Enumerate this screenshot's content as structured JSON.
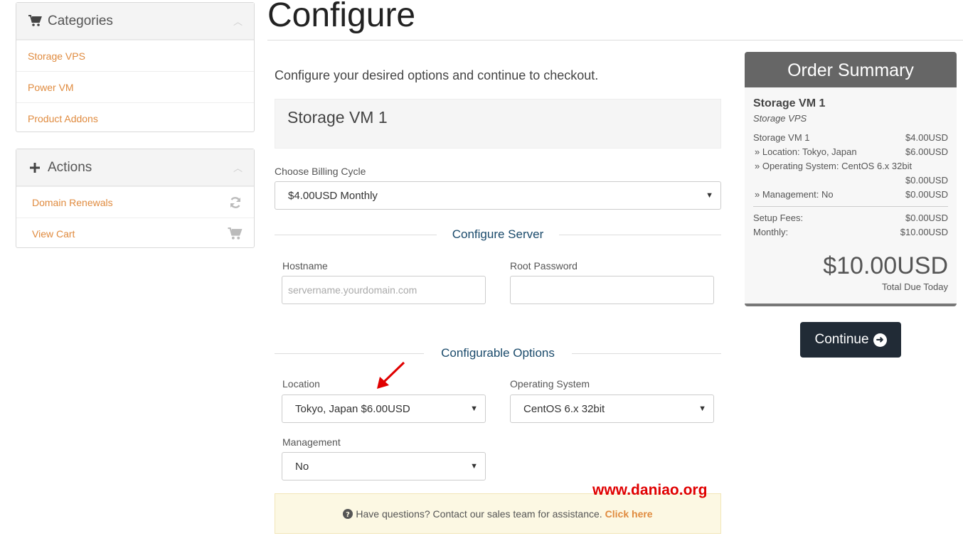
{
  "sidebar": {
    "categories": {
      "title": "Categories",
      "icon": "cart-icon",
      "items": [
        {
          "label": "Storage VPS"
        },
        {
          "label": "Power VM"
        },
        {
          "label": "Product Addons"
        }
      ]
    },
    "actions": {
      "title": "Actions",
      "icon": "plus-icon",
      "items": [
        {
          "label": "Domain Renewals",
          "icon": "refresh-icon"
        },
        {
          "label": "View Cart",
          "icon": "cart-icon"
        }
      ]
    }
  },
  "page": {
    "title": "Configure",
    "intro": "Configure your desired options and continue to checkout."
  },
  "product": {
    "name": "Storage VM 1"
  },
  "billing": {
    "label": "Choose Billing Cycle",
    "value": "$4.00USD Monthly"
  },
  "configure_server": {
    "heading": "Configure Server",
    "hostname_label": "Hostname",
    "hostname_placeholder": "servername.yourdomain.com",
    "hostname_value": "",
    "password_label": "Root Password",
    "password_value": ""
  },
  "configurable_options": {
    "heading": "Configurable Options",
    "location_label": "Location",
    "location_value": "Tokyo, Japan $6.00USD",
    "os_label": "Operating System",
    "os_value": "CentOS 6.x 32bit",
    "management_label": "Management",
    "management_value": "No"
  },
  "help": {
    "text": "Have questions? Contact our sales team for assistance.",
    "link": "Click here",
    "icon": "question-circle-icon"
  },
  "watermark": "www.daniao.org",
  "order_summary": {
    "title": "Order Summary",
    "product_name": "Storage VM 1",
    "product_group": "Storage VPS",
    "lines": [
      {
        "label": "Storage VM 1",
        "amount": "$4.00USD"
      },
      {
        "label": "» Location: Tokyo, Japan",
        "amount": "$6.00USD"
      },
      {
        "label": "» Operating System: CentOS 6.x 32bit",
        "amount": ""
      },
      {
        "label": "",
        "amount": "$0.00USD"
      },
      {
        "label": "» Management: No",
        "amount": "$0.00USD"
      }
    ],
    "setup_label": "Setup Fees:",
    "setup_amount": "$0.00USD",
    "monthly_label": "Monthly:",
    "monthly_amount": "$10.00USD",
    "total": "$10.00USD",
    "total_label": "Total Due Today"
  },
  "continue_button": {
    "label": "Continue",
    "icon": "arrow-circle-right-icon"
  },
  "colors": {
    "accent_link": "#e08b3f",
    "section_heading": "#1a4a6b",
    "summary_header": "#666666",
    "continue_button": "#212b36",
    "annotation_arrow": "#e00000"
  }
}
